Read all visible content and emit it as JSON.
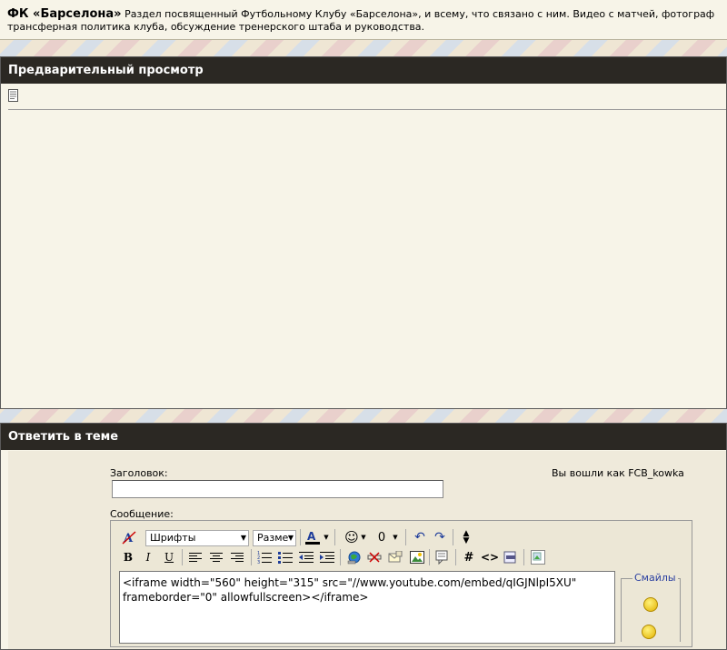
{
  "forum": {
    "title": "ФК «Барселона»",
    "description": "Раздел посвященный Футбольному Клубу «Барселона», и всему, что связано с ним. Видео с матчей, фотограф",
    "description_line2": "трансферная политика клуба, обсуждение тренерского штаба и руководства."
  },
  "preview": {
    "heading": "Предварительный просмотр"
  },
  "reply": {
    "heading": "Ответить в теме",
    "title_label": "Заголовок:",
    "logged_in": "Вы вошли как FCB_kowka",
    "message_label": "Сообщение:",
    "title_value": "",
    "message_value": "<iframe width=\"560\" height=\"315\" src=\"//www.youtube.com/embed/qIGJNlpI5XU\"\nframeborder=\"0\" allowfullscreen></iframe>"
  },
  "toolbar": {
    "font_select": "Шрифты",
    "size_select": "Разме",
    "bold": "B",
    "italic": "I",
    "underline": "U"
  },
  "smiles": {
    "legend": "Смайлы"
  },
  "colors": {
    "header_bg": "#2b2823",
    "panel_bg": "#f7f4e8",
    "link_blue": "#2a3fa0"
  }
}
